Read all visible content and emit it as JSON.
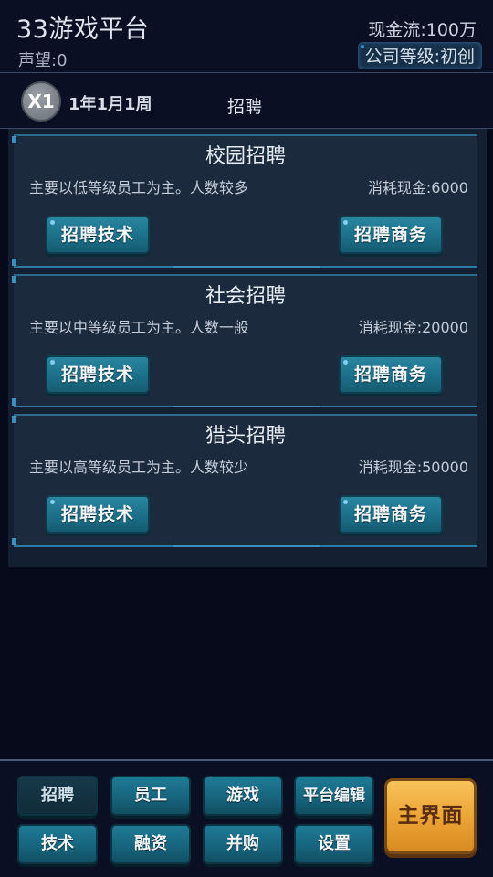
{
  "header": {
    "title": "33游戏平台",
    "reputation": "声望:0",
    "cashflow": "现金流:100万",
    "company_level": "公司等级:初创"
  },
  "status": {
    "speed": "X1",
    "date": "1年1月1周",
    "panel_title": "招聘"
  },
  "recruit_options": [
    {
      "title": "校园招聘",
      "description": "主要以低等级员工为主。人数较多",
      "cost": "消耗现金:6000",
      "tech_button": "招聘技术",
      "business_button": "招聘商务"
    },
    {
      "title": "社会招聘",
      "description": "主要以中等级员工为主。人数一般",
      "cost": "消耗现金:20000",
      "tech_button": "招聘技术",
      "business_button": "招聘商务"
    },
    {
      "title": "猎头招聘",
      "description": "主要以高等级员工为主。人数较少",
      "cost": "消耗现金:50000",
      "tech_button": "招聘技术",
      "business_button": "招聘商务"
    }
  ],
  "nav": {
    "row1": [
      "招聘",
      "员工",
      "游戏",
      "平台编辑"
    ],
    "row2": [
      "技术",
      "融资",
      "并购",
      "设置"
    ],
    "active": "招聘",
    "main_button": "主界面"
  },
  "colors": {
    "background": "#070a1a",
    "panel": "#142031",
    "card": "#1b2a3d",
    "button_teal": "#1b6f88",
    "main_button": "#eaa233"
  }
}
